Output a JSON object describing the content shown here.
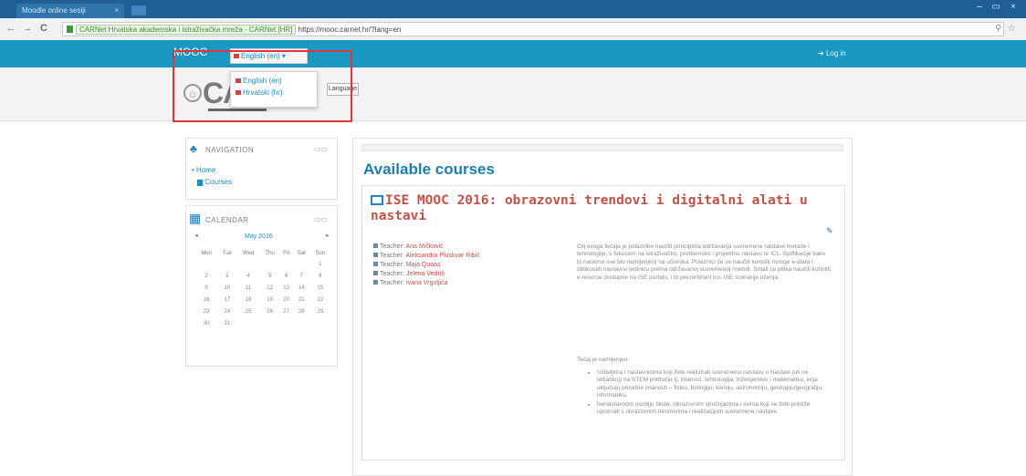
{
  "browser": {
    "tab_title": "Moodle online sesiji",
    "tab_close": "×",
    "window_controls": [
      "–",
      "▭",
      "×"
    ],
    "nav_buttons": [
      "←",
      "→",
      "C"
    ],
    "cert_label": "CARNet Hrvatska akademska i istraživačka mreža - CARNet [HR]",
    "url_scheme": "https://",
    "url_host": "mooc.carnet.hr",
    "url_path": "/?lang=en",
    "addr_icons": [
      "zoom-icon",
      "star-icon"
    ]
  },
  "navbar": {
    "brand": "MOOC",
    "language_button": "English (en) ▾",
    "login": "Log in"
  },
  "language_menu": {
    "items": [
      "English (en)",
      "Hrvatski (hr)"
    ],
    "tooltip": "Language"
  },
  "header": {
    "logo_text": "CA"
  },
  "navigation_block": {
    "title": "NAVIGATION",
    "home": "Home",
    "courses": "Courses"
  },
  "calendar_block": {
    "title": "CALENDAR",
    "month": "May 2016",
    "prev": "◄",
    "next": "►",
    "weekdays": [
      "Mon",
      "Tue",
      "Wed",
      "Thu",
      "Fri",
      "Sat",
      "Sun"
    ],
    "weeks": [
      [
        "",
        "",
        "",
        "",
        "",
        "",
        "1"
      ],
      [
        "2",
        "3",
        "4",
        "5",
        "6",
        "7",
        "8"
      ],
      [
        "9",
        "10",
        "11",
        "12",
        "13",
        "14",
        "15"
      ],
      [
        "16",
        "17",
        "18",
        "19",
        "20",
        "21",
        "22"
      ],
      [
        "23",
        "24",
        "25",
        "26",
        "27",
        "28",
        "29"
      ],
      [
        "30",
        "31",
        "",
        "",
        "",
        "",
        ""
      ]
    ]
  },
  "main": {
    "heading": "Available courses",
    "course": {
      "title": "ISE MOOC 2016: obrazovni trendovi i digitalni alati u nastavi",
      "teacher_label": "Teacher:",
      "teachers": [
        "Ana Mičković",
        "Aleksandra Pluskvar Ribić",
        "Maja Quaas",
        "Jelena Vedriš",
        "Ivana Vrgoljića"
      ],
      "summary_para1": "Cilj ovoga tečaja je polaznike naučiti principima održavanja suvremene nastave metode i tehnologije, s fokusom na istraživačko, problemsko i projektno nastavu te ICL. Spiflikacije kako bi naravno sve bio namijenjeni na učionika. Polaznici će se naučiti koristiti mnoge e-alata i oblikovati nastavnu jedinicu prema održavanoj suvremenoj metodi. Small će pitika naučiti koristiti e-resurse dostupne na ISE portalu, i to prezentirani ico. ISE scenarije učenja.",
      "summary_para2": "Tečaj je namijenjen:",
      "summary_list": [
        "Učiteljima i nastavnicima koji žele realizirati suvremenu nastavu u Nastavi (uli ne letljačkoj) na STEM područje tj. znanost, tehnologija, inženjerstvo i matematiku, koja uključuju prirodne znanosti – fiziku, biologiju, kemiju, astronomiju, geologiju/geografiju, informatiku.",
        "Nenastavnom osoblju škola, obrazovnim stručnjacima i svima koji se žele pobliže upoznati s obrazovnim trendovima i realizacijom suvremene nastave."
      ]
    }
  },
  "colors": {
    "navbar": "#1a98c2",
    "heading": "#1a7fae",
    "course_title": "#c2524a",
    "highlight": "#e0363a"
  }
}
